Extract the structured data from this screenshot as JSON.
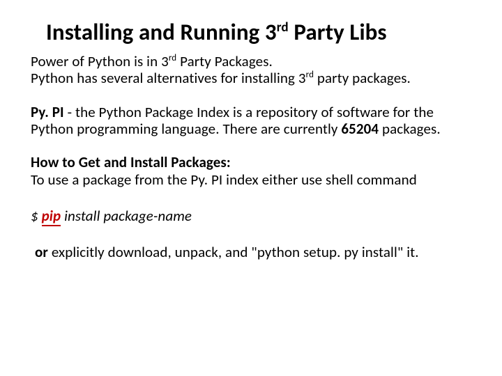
{
  "title": {
    "pre": "Installing and Running 3",
    "sup": "rd",
    "post": " Party Libs"
  },
  "intro1": {
    "pre": "Power of Python is in 3",
    "sup": "rd",
    "post": " Party Packages."
  },
  "intro2": {
    "pre": "Python has several alternatives for installing 3",
    "sup": "rd",
    "post": " party packages."
  },
  "pypi": {
    "name": "Py. PI",
    "desc1": " - the Python Package Index is a repository of software for the Python programming language. There are currently ",
    "count": "65204",
    "desc2": " packages."
  },
  "howto": {
    "heading": "How to Get and Install Packages:",
    "line": "To use a package from the Py. PI index either use shell command"
  },
  "cmd": {
    "prefix": "$ ",
    "pip": "pip",
    "rest": " install package-name"
  },
  "alt": {
    "or": "or",
    "rest": " explicitly download, unpack, and \"python setup. py install\" it."
  }
}
